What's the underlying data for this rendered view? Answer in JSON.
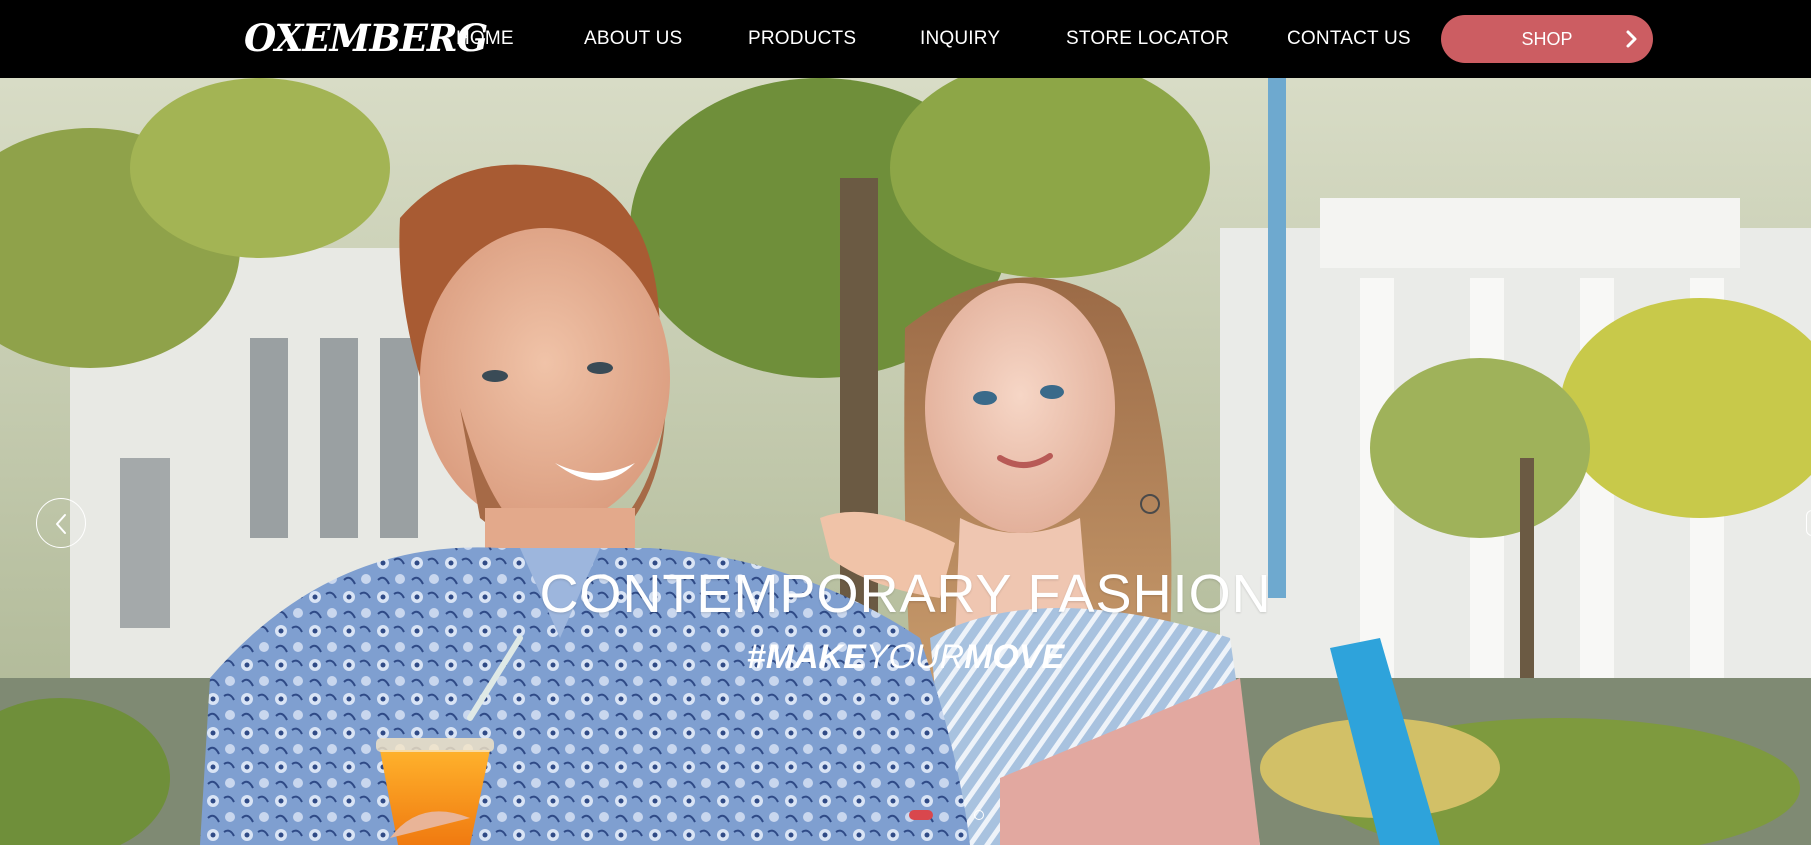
{
  "brand": {
    "logo_text": "OXEMBERG"
  },
  "nav": {
    "items": [
      {
        "label": "HOME"
      },
      {
        "label": "ABOUT US"
      },
      {
        "label": "PRODUCTS"
      },
      {
        "label": "INQUIRY"
      },
      {
        "label": "STORE LOCATOR"
      },
      {
        "label": "CONTACT US"
      }
    ],
    "shop_label": "SHOP"
  },
  "hero": {
    "headline": "CONTEMPORARY FASHION",
    "hashtag": {
      "part1": "#MAKE",
      "part2": "YOUR",
      "part3": "MOVE"
    },
    "slide_count": 2,
    "active_slide": 1
  },
  "icons": {
    "shop": "chevron-right-icon",
    "prev": "chevron-left-icon"
  },
  "colors": {
    "header_bg": "#000000",
    "shop_button": "#cc5d62",
    "active_dot": "#d9474d",
    "text": "#ffffff"
  }
}
